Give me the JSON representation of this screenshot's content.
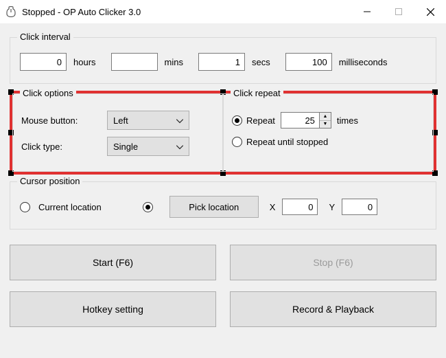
{
  "titlebar": {
    "title": "Stopped - OP Auto Clicker 3.0"
  },
  "interval": {
    "group_title": "Click interval",
    "hours": "0",
    "hours_unit": "hours",
    "mins": "",
    "mins_unit": "mins",
    "secs": "1",
    "secs_unit": "secs",
    "ms": "100",
    "ms_unit": "milliseconds"
  },
  "options": {
    "group_title": "Click options",
    "mouse_button_label": "Mouse button:",
    "mouse_button_value": "Left",
    "click_type_label": "Click type:",
    "click_type_value": "Single"
  },
  "repeat": {
    "group_title": "Click repeat",
    "repeat_label": "Repeat",
    "repeat_value": "25",
    "times_label": "times",
    "until_stopped_label": "Repeat until stopped"
  },
  "cursor": {
    "group_title": "Cursor position",
    "current_label": "Current location",
    "pick_label": "Pick location",
    "x_label": "X",
    "x_value": "0",
    "y_label": "Y",
    "y_value": "0"
  },
  "buttons": {
    "start": "Start (F6)",
    "stop": "Stop (F6)",
    "hotkey": "Hotkey setting",
    "record": "Record & Playback"
  }
}
